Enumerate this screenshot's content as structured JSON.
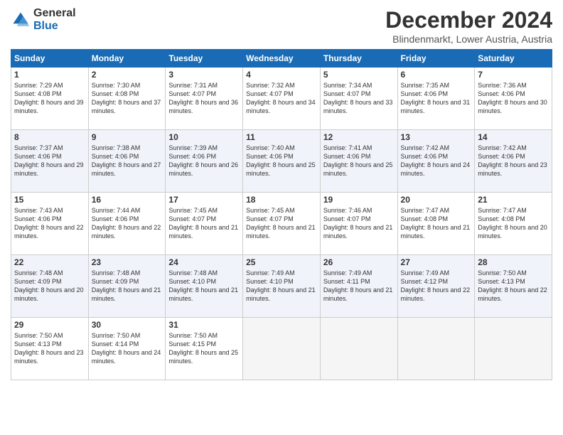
{
  "logo": {
    "general": "General",
    "blue": "Blue"
  },
  "header": {
    "month": "December 2024",
    "location": "Blindenmarkt, Lower Austria, Austria"
  },
  "days_of_week": [
    "Sunday",
    "Monday",
    "Tuesday",
    "Wednesday",
    "Thursday",
    "Friday",
    "Saturday"
  ],
  "weeks": [
    [
      {
        "day": "1",
        "sunrise": "7:29 AM",
        "sunset": "4:08 PM",
        "daylight": "8 hours and 39 minutes."
      },
      {
        "day": "2",
        "sunrise": "7:30 AM",
        "sunset": "4:08 PM",
        "daylight": "8 hours and 37 minutes."
      },
      {
        "day": "3",
        "sunrise": "7:31 AM",
        "sunset": "4:07 PM",
        "daylight": "8 hours and 36 minutes."
      },
      {
        "day": "4",
        "sunrise": "7:32 AM",
        "sunset": "4:07 PM",
        "daylight": "8 hours and 34 minutes."
      },
      {
        "day": "5",
        "sunrise": "7:34 AM",
        "sunset": "4:07 PM",
        "daylight": "8 hours and 33 minutes."
      },
      {
        "day": "6",
        "sunrise": "7:35 AM",
        "sunset": "4:06 PM",
        "daylight": "8 hours and 31 minutes."
      },
      {
        "day": "7",
        "sunrise": "7:36 AM",
        "sunset": "4:06 PM",
        "daylight": "8 hours and 30 minutes."
      }
    ],
    [
      {
        "day": "8",
        "sunrise": "7:37 AM",
        "sunset": "4:06 PM",
        "daylight": "8 hours and 29 minutes."
      },
      {
        "day": "9",
        "sunrise": "7:38 AM",
        "sunset": "4:06 PM",
        "daylight": "8 hours and 27 minutes."
      },
      {
        "day": "10",
        "sunrise": "7:39 AM",
        "sunset": "4:06 PM",
        "daylight": "8 hours and 26 minutes."
      },
      {
        "day": "11",
        "sunrise": "7:40 AM",
        "sunset": "4:06 PM",
        "daylight": "8 hours and 25 minutes."
      },
      {
        "day": "12",
        "sunrise": "7:41 AM",
        "sunset": "4:06 PM",
        "daylight": "8 hours and 25 minutes."
      },
      {
        "day": "13",
        "sunrise": "7:42 AM",
        "sunset": "4:06 PM",
        "daylight": "8 hours and 24 minutes."
      },
      {
        "day": "14",
        "sunrise": "7:42 AM",
        "sunset": "4:06 PM",
        "daylight": "8 hours and 23 minutes."
      }
    ],
    [
      {
        "day": "15",
        "sunrise": "7:43 AM",
        "sunset": "4:06 PM",
        "daylight": "8 hours and 22 minutes."
      },
      {
        "day": "16",
        "sunrise": "7:44 AM",
        "sunset": "4:06 PM",
        "daylight": "8 hours and 22 minutes."
      },
      {
        "day": "17",
        "sunrise": "7:45 AM",
        "sunset": "4:07 PM",
        "daylight": "8 hours and 21 minutes."
      },
      {
        "day": "18",
        "sunrise": "7:45 AM",
        "sunset": "4:07 PM",
        "daylight": "8 hours and 21 minutes."
      },
      {
        "day": "19",
        "sunrise": "7:46 AM",
        "sunset": "4:07 PM",
        "daylight": "8 hours and 21 minutes."
      },
      {
        "day": "20",
        "sunrise": "7:47 AM",
        "sunset": "4:08 PM",
        "daylight": "8 hours and 21 minutes."
      },
      {
        "day": "21",
        "sunrise": "7:47 AM",
        "sunset": "4:08 PM",
        "daylight": "8 hours and 20 minutes."
      }
    ],
    [
      {
        "day": "22",
        "sunrise": "7:48 AM",
        "sunset": "4:09 PM",
        "daylight": "8 hours and 20 minutes."
      },
      {
        "day": "23",
        "sunrise": "7:48 AM",
        "sunset": "4:09 PM",
        "daylight": "8 hours and 21 minutes."
      },
      {
        "day": "24",
        "sunrise": "7:48 AM",
        "sunset": "4:10 PM",
        "daylight": "8 hours and 21 minutes."
      },
      {
        "day": "25",
        "sunrise": "7:49 AM",
        "sunset": "4:10 PM",
        "daylight": "8 hours and 21 minutes."
      },
      {
        "day": "26",
        "sunrise": "7:49 AM",
        "sunset": "4:11 PM",
        "daylight": "8 hours and 21 minutes."
      },
      {
        "day": "27",
        "sunrise": "7:49 AM",
        "sunset": "4:12 PM",
        "daylight": "8 hours and 22 minutes."
      },
      {
        "day": "28",
        "sunrise": "7:50 AM",
        "sunset": "4:13 PM",
        "daylight": "8 hours and 22 minutes."
      }
    ],
    [
      {
        "day": "29",
        "sunrise": "7:50 AM",
        "sunset": "4:13 PM",
        "daylight": "8 hours and 23 minutes."
      },
      {
        "day": "30",
        "sunrise": "7:50 AM",
        "sunset": "4:14 PM",
        "daylight": "8 hours and 24 minutes."
      },
      {
        "day": "31",
        "sunrise": "7:50 AM",
        "sunset": "4:15 PM",
        "daylight": "8 hours and 25 minutes."
      },
      null,
      null,
      null,
      null
    ]
  ],
  "labels": {
    "sunrise": "Sunrise:",
    "sunset": "Sunset:",
    "daylight": "Daylight:"
  }
}
